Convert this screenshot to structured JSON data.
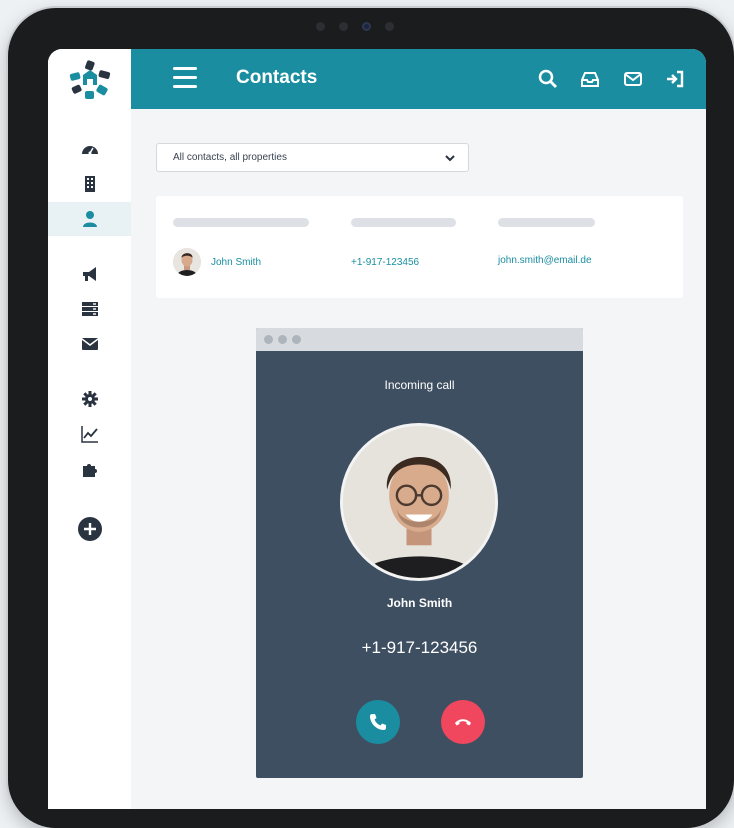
{
  "header": {
    "title": "Contacts"
  },
  "filter": {
    "selected": "All contacts, all properties"
  },
  "contacts": [
    {
      "name": "John Smith",
      "phone": "+1-917-123456",
      "email": "john.smith@email.de"
    }
  ],
  "call": {
    "status": "Incoming call",
    "caller_name": "John Smith",
    "caller_phone": "+1-917-123456"
  },
  "icons": {
    "sidebar": [
      "dashboard-icon",
      "building-icon",
      "user-icon",
      "megaphone-icon",
      "server-icon",
      "mail-icon",
      "gear-icon",
      "chart-icon",
      "puzzle-icon",
      "plus-circle-icon"
    ],
    "header": [
      "menu-icon",
      "search-icon",
      "inbox-icon",
      "envelope-icon",
      "sign-in-icon"
    ]
  },
  "colors": {
    "brand": "#1a8ea0",
    "accept": "#1a8ea0",
    "decline": "#f0475e",
    "call_bg": "#3e4f61"
  }
}
